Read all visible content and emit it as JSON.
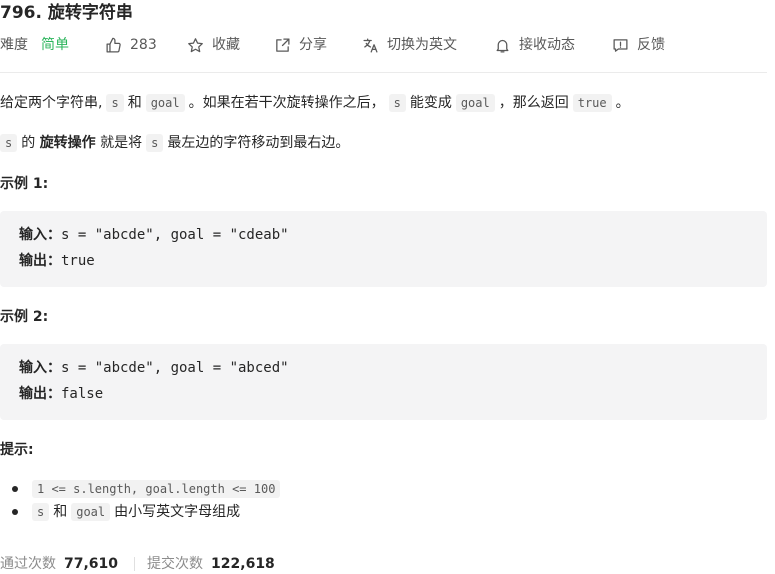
{
  "problem": {
    "title": "796. 旋转字符串"
  },
  "toolbar": {
    "difficulty_label": "难度",
    "difficulty_value": "简单",
    "like_count": "283",
    "favorite_label": "收藏",
    "share_label": "分享",
    "switch_lang_label": "切换为英文",
    "notify_label": "接收动态",
    "feedback_label": "反馈"
  },
  "description": {
    "p1_a": "给定两个字符串,",
    "code_s": "s",
    "and": "和",
    "code_goal": "goal",
    "p1_b": "。如果在若干次旋转操作之后，",
    "p1_c": "能变成",
    "p1_d": "，那么返回",
    "code_true": "true",
    "p1_e": "。",
    "p2_a": "的",
    "p2_bold": "旋转操作",
    "p2_b": "就是将",
    "p2_c": "最左边的字符移动到最右边。"
  },
  "examples": [
    {
      "heading": "示例 1:",
      "input_label": "输入：",
      "input_value": "s = \"abcde\", goal = \"cdeab\"",
      "output_label": "输出：",
      "output_value": "true"
    },
    {
      "heading": "示例 2:",
      "input_label": "输入：",
      "input_value": "s = \"abcde\", goal = \"abced\"",
      "output_label": "输出：",
      "output_value": "false"
    }
  ],
  "hints": {
    "heading": "提示:",
    "item1_code": "1 <= s.length, goal.length <= 100",
    "item2_s": "s",
    "item2_and": "和",
    "item2_goal": "goal",
    "item2_text": "由小写英文字母组成"
  },
  "stats": {
    "accepted_label": "通过次数",
    "accepted_value": "77,610",
    "submitted_label": "提交次数",
    "submitted_value": "122,618"
  },
  "colors": {
    "easy": "#2db55d",
    "code_bg": "#f2f2f2",
    "example_bg": "#f4f4f5"
  }
}
